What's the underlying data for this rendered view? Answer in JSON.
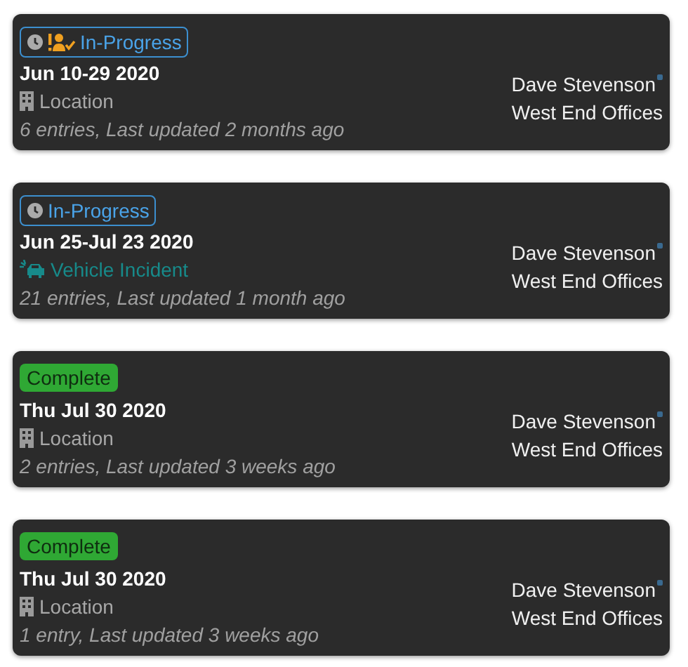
{
  "cards": [
    {
      "status": {
        "kind": "in-progress",
        "label": "In-Progress",
        "clock": true,
        "assignee": true
      },
      "date": "Jun 10-29 2020",
      "category": {
        "kind": "location",
        "label": "Location"
      },
      "summary": "6 entries, Last updated 2 months ago",
      "person": "Dave Stevenson",
      "site": "West End Offices"
    },
    {
      "status": {
        "kind": "in-progress",
        "label": "In-Progress",
        "clock": true,
        "assignee": false
      },
      "date": "Jun 25-Jul 23 2020",
      "category": {
        "kind": "vehicle",
        "label": "Vehicle Incident"
      },
      "summary": "21 entries, Last updated 1 month ago",
      "person": "Dave Stevenson",
      "site": "West End Offices"
    },
    {
      "status": {
        "kind": "complete",
        "label": "Complete",
        "clock": false,
        "assignee": false
      },
      "date": "Thu Jul 30 2020",
      "category": {
        "kind": "location",
        "label": "Location"
      },
      "summary": "2 entries, Last updated 3 weeks ago",
      "person": "Dave Stevenson",
      "site": "West End Offices"
    },
    {
      "status": {
        "kind": "complete",
        "label": "Complete",
        "clock": false,
        "assignee": false
      },
      "date": "Thu Jul 30 2020",
      "category": {
        "kind": "location",
        "label": "Location"
      },
      "summary": "1 entry, Last updated 3 weeks ago",
      "person": "Dave Stevenson",
      "site": "West End Offices"
    }
  ]
}
